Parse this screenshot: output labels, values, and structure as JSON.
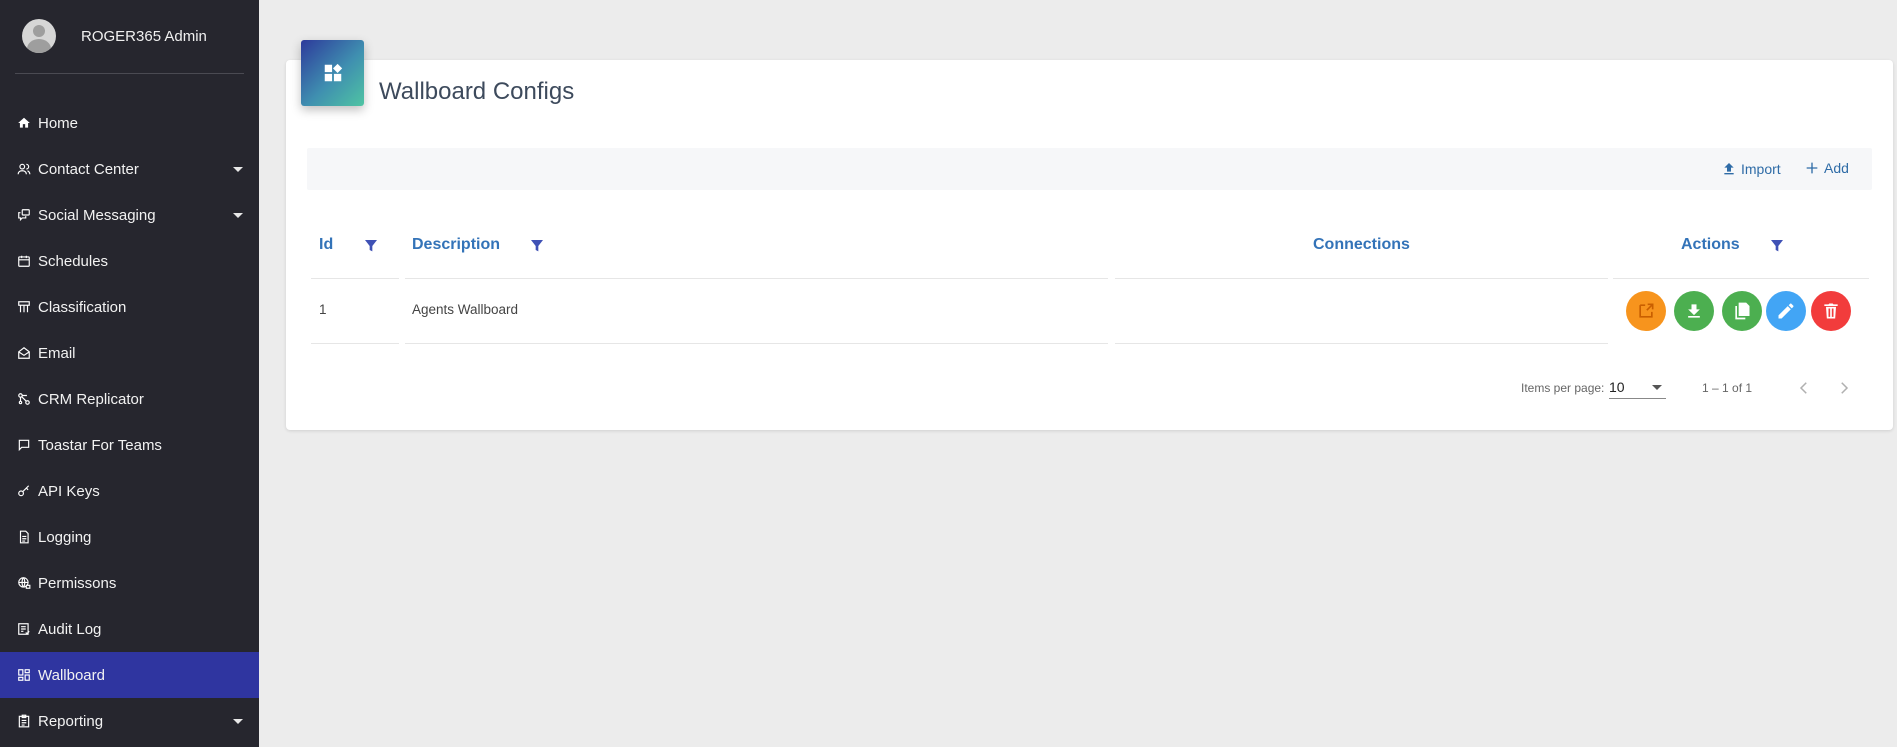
{
  "user": {
    "name": "ROGER365 Admin"
  },
  "sidebar": {
    "items": [
      {
        "label": "Home",
        "icon": "home-icon"
      },
      {
        "label": "Contact Center",
        "icon": "people-icon",
        "expandable": true
      },
      {
        "label": "Social Messaging",
        "icon": "chat-icon",
        "expandable": true
      },
      {
        "label": "Schedules",
        "icon": "calendar-icon"
      },
      {
        "label": "Classification",
        "icon": "hierarchy-icon"
      },
      {
        "label": "Email",
        "icon": "mail-icon"
      },
      {
        "label": "CRM Replicator",
        "icon": "nodes-icon"
      },
      {
        "label": "Toastar For Teams",
        "icon": "message-square-icon"
      },
      {
        "label": "API Keys",
        "icon": "key-icon"
      },
      {
        "label": "Logging",
        "icon": "document-icon"
      },
      {
        "label": "Permissons",
        "icon": "globe-lock-icon"
      },
      {
        "label": "Audit Log",
        "icon": "checklist-icon"
      },
      {
        "label": "Wallboard",
        "icon": "dashboard-icon",
        "active": true
      },
      {
        "label": "Reporting",
        "icon": "clipboard-icon",
        "expandable": true
      }
    ]
  },
  "page": {
    "title": "Wallboard Configs"
  },
  "toolbar": {
    "import_label": "Import",
    "add_label": "Add"
  },
  "table": {
    "headers": {
      "id": "Id",
      "description": "Description",
      "connections": "Connections",
      "actions": "Actions"
    },
    "rows": [
      {
        "id": "1",
        "description": "Agents Wallboard",
        "connections": ""
      }
    ]
  },
  "actions": [
    {
      "name": "open-external-button",
      "icon": "open-external-icon",
      "color": "#f7941d"
    },
    {
      "name": "download-button",
      "icon": "download-icon",
      "color": "#4caf50"
    },
    {
      "name": "copy-button",
      "icon": "copy-icon",
      "color": "#4caf50"
    },
    {
      "name": "edit-button",
      "icon": "pencil-icon",
      "color": "#42a5f5"
    },
    {
      "name": "delete-button",
      "icon": "trash-icon",
      "color": "#f23c3c"
    }
  ],
  "pagination": {
    "items_per_page_label": "Items per page:",
    "page_size": "10",
    "range_label": "1 – 1 of 1"
  },
  "colors": {
    "sidebar_bg": "#26262e",
    "active_item": "#2f35a0",
    "header_text": "#3373b8",
    "filter_icon": "#3f51b5",
    "link": "#2f6ca7"
  }
}
